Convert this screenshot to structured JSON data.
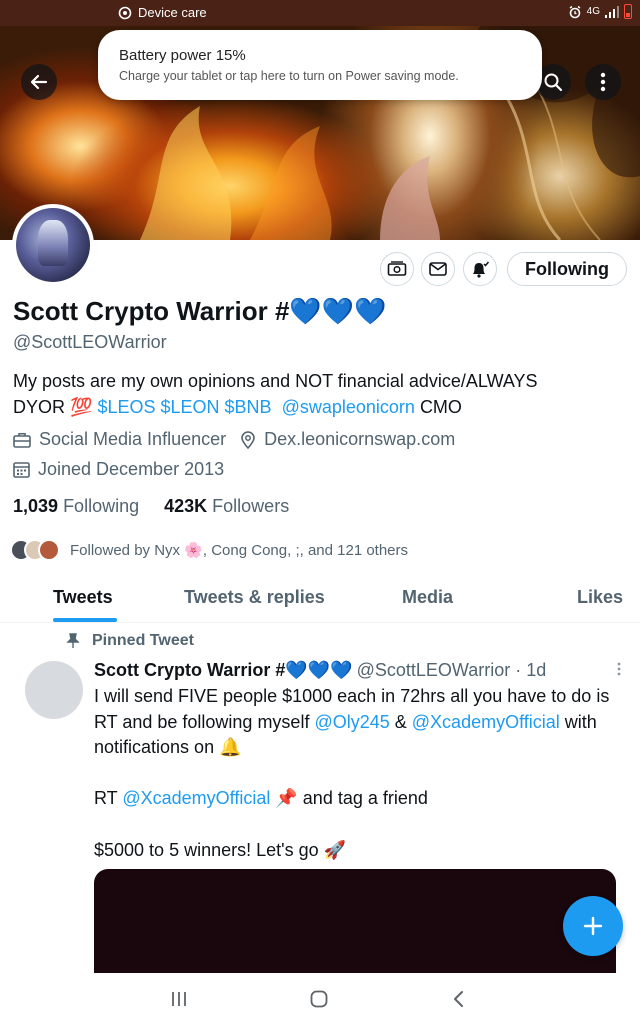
{
  "status_bar": {
    "label": "Device care",
    "network": "4G"
  },
  "toast": {
    "title": "Battery power 15%",
    "body": "Charge your tablet or tap here to turn on Power saving mode."
  },
  "profile": {
    "name": "Scott Crypto Warrior #",
    "name_emoji": "💙💙💙",
    "handle": "@ScottLEOWarrior",
    "follow_button": "Following",
    "bio": {
      "line1": "My posts are my own opinions and NOT financial advice/ALWAYS",
      "dyor": "DYOR",
      "emoji_100": "💯",
      "tags": "$LEOS $LEON $BNB",
      "mention": "@swapleonicorn",
      "suffix": "CMO"
    },
    "category": "Social Media Influencer",
    "website": "Dex.leonicornswap.com",
    "joined": "Joined December 2013",
    "following_count": "1,039",
    "following_label": "Following",
    "followers_count": "423K",
    "followers_label": "Followers",
    "followed_by": "Followed by Nyx 🌸, Cong Cong, ;, and 121 others"
  },
  "tabs": [
    "Tweets",
    "Tweets & replies",
    "Media",
    "Likes"
  ],
  "tweet": {
    "pinned_label": "Pinned Tweet",
    "author": "Scott Crypto Warrior #",
    "author_emoji": "💙💙💙",
    "handle_time": "@ScottLEOWarrior · 1d",
    "p1_a": "I will send FIVE people $1000 each in 72hrs all you have to do is RT and be following myself ",
    "p1_m1": "@Oly245",
    "p1_b": " & ",
    "p1_m2": "@XcademyOfficial",
    "p1_c": " with notifications on ",
    "p1_emoji": "🔔",
    "p2_a": "RT ",
    "p2_m": "@XcademyOfficial",
    "p2_emoji": "📌",
    "p2_b": " and tag a friend",
    "p3": "$5000 to 5 winners! Let's go ",
    "p3_emoji": "🚀"
  },
  "colors": {
    "accent": "#1d9bf0",
    "text": "#0f1419",
    "secondary": "#536471",
    "status_bar": "#4a2316"
  }
}
